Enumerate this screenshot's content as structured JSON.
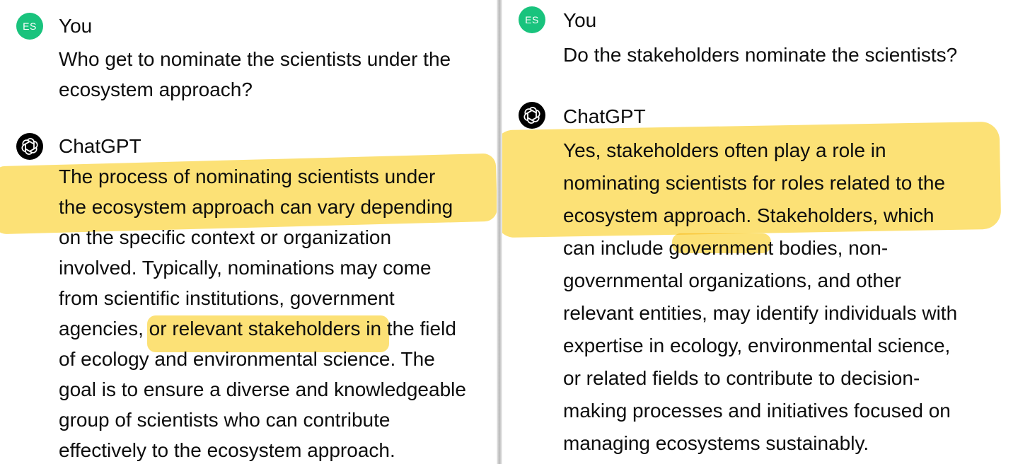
{
  "left": {
    "user": {
      "avatar_initials": "ES",
      "name": "You",
      "message_lines": [
        "Who get to nominate the scientists under the",
        "ecosystem approach?"
      ]
    },
    "assistant": {
      "avatar_icon": "openai-logo-icon",
      "name": "ChatGPT",
      "message_lines": [
        "The process of nominating scientists under",
        "the ecosystem approach can vary depending",
        "on the specific context or organization",
        "involved. Typically, nominations may come",
        "from scientific institutions, government",
        "agencies, or relevant stakeholders in the field",
        "of ecology and environmental science. The",
        "goal is to ensure a diverse and knowledgeable",
        "group of scientists who can contribute",
        "effectively to the ecosystem approach."
      ]
    }
  },
  "right": {
    "user": {
      "avatar_initials": "ES",
      "name": "You",
      "message_lines": [
        "Do the stakeholders nominate the scientists?"
      ]
    },
    "assistant": {
      "avatar_icon": "openai-logo-icon",
      "name": "ChatGPT",
      "message_lines": [
        "Yes, stakeholders often play a role in",
        "nominating scientists for roles related to the",
        "ecosystem approach. Stakeholders, which",
        "can include government bodies, non-",
        "governmental organizations, and other",
        "relevant entities, may identify individuals with",
        "expertise in ecology, environmental science,",
        "or related fields to contribute to decision-",
        "making processes and initiatives focused on",
        "managing ecosystems sustainably."
      ]
    }
  },
  "colors": {
    "user_avatar": "#19c37d",
    "assistant_avatar": "#000000",
    "highlight": "#fbd94f",
    "text": "#0d0d0d"
  }
}
